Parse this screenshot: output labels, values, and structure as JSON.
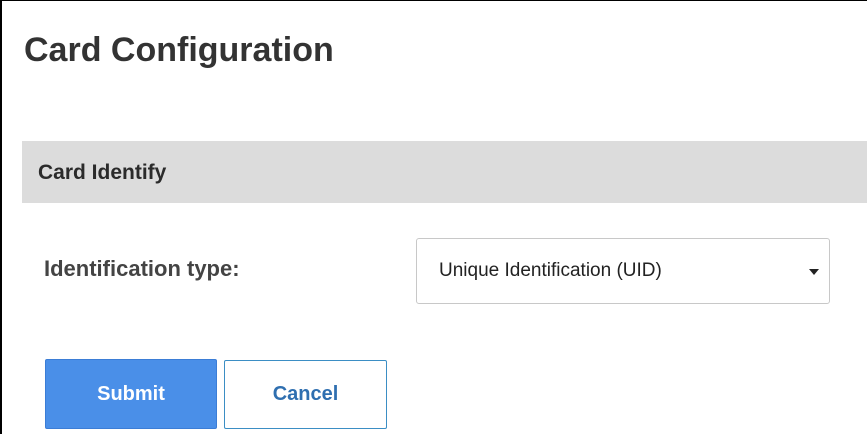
{
  "page": {
    "title": "Card Configuration"
  },
  "section": {
    "title": "Card Identify"
  },
  "form": {
    "identification_type_label": "Identification type:",
    "identification_type_value": "Unique Identification (UID)"
  },
  "buttons": {
    "submit_label": "Submit",
    "cancel_label": "Cancel"
  },
  "icons": {
    "select_caret": "chevron-down-icon"
  },
  "colors": {
    "primary_button": "#4a8fe8",
    "cancel_text": "#2f6fb0",
    "section_bar": "#dcdcdc"
  }
}
